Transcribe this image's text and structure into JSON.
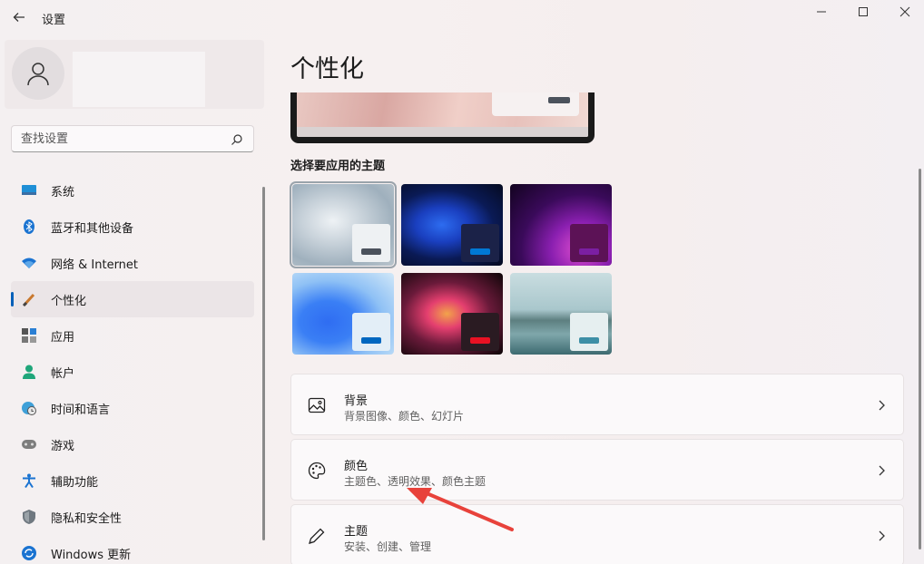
{
  "window": {
    "title": "设置"
  },
  "search": {
    "placeholder": "查找设置"
  },
  "nav": [
    {
      "label": "系统",
      "icon": "monitor-icon"
    },
    {
      "label": "蓝牙和其他设备",
      "icon": "bluetooth-icon"
    },
    {
      "label": "网络 & Internet",
      "icon": "wifi-icon"
    },
    {
      "label": "个性化",
      "icon": "brush-icon",
      "active": true
    },
    {
      "label": "应用",
      "icon": "apps-icon"
    },
    {
      "label": "帐户",
      "icon": "person-icon"
    },
    {
      "label": "时间和语言",
      "icon": "globe-clock-icon"
    },
    {
      "label": "游戏",
      "icon": "gamepad-icon"
    },
    {
      "label": "辅助功能",
      "icon": "accessibility-icon"
    },
    {
      "label": "隐私和安全性",
      "icon": "shield-icon"
    },
    {
      "label": "Windows 更新",
      "icon": "update-icon"
    }
  ],
  "main": {
    "title": "个性化",
    "themes_label": "选择要应用的主题",
    "themes": [
      {
        "name": "light",
        "accent": "#4b525c",
        "selected": true
      },
      {
        "name": "dark",
        "accent": "#0078d4"
      },
      {
        "name": "glow",
        "accent": "#7b1fa2"
      },
      {
        "name": "bloom-light",
        "accent": "#0067c0"
      },
      {
        "name": "captured-motion",
        "accent": "#e81123"
      },
      {
        "name": "flow",
        "accent": "#3d8fa6"
      }
    ],
    "cards": [
      {
        "title": "背景",
        "subtitle": "背景图像、颜色、幻灯片",
        "icon": "image-icon"
      },
      {
        "title": "颜色",
        "subtitle": "主题色、透明效果、颜色主题",
        "icon": "palette-icon"
      },
      {
        "title": "主题",
        "subtitle": "安装、创建、管理",
        "icon": "pen-icon"
      }
    ]
  },
  "colors": {
    "accent": "#005fb8",
    "annotation_arrow": "#e8423b"
  }
}
